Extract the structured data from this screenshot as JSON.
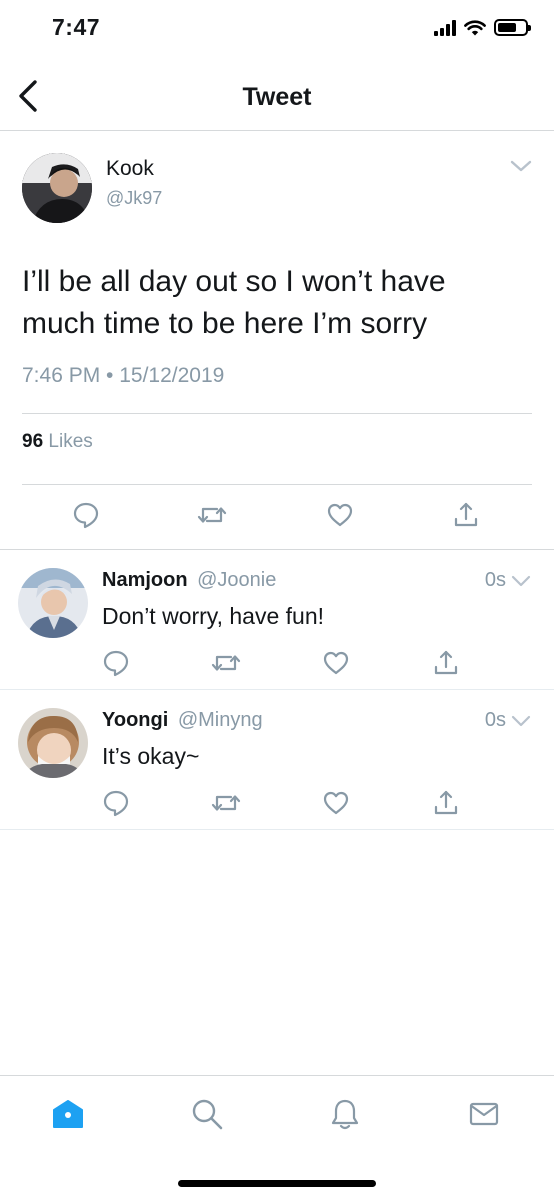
{
  "status_bar": {
    "time": "7:47"
  },
  "nav": {
    "title": "Tweet"
  },
  "tweet": {
    "name": "Kook",
    "handle": "@Jk97",
    "text": "I’ll be all day out so I won’t have much time to be here I’m sorry",
    "meta": "7:46 PM • 15/12/2019",
    "likes_count": "96",
    "likes_label": "Likes"
  },
  "replies": [
    {
      "name": "Namjoon",
      "handle": "@Joonie",
      "time": "0s",
      "text": "Don’t worry, have fun!"
    },
    {
      "name": "Yoongi",
      "handle": "@Minyng",
      "time": "0s",
      "text": "It’s okay~"
    }
  ],
  "colors": {
    "accent": "#1da1f2",
    "icon_gray": "#8899a6",
    "divider": "#d6d9db"
  },
  "icons": {
    "actions": [
      "reply-icon",
      "retweet-icon",
      "like-icon",
      "share-icon"
    ],
    "tabs": [
      "home-icon",
      "search-icon",
      "notifications-icon",
      "messages-icon"
    ]
  }
}
